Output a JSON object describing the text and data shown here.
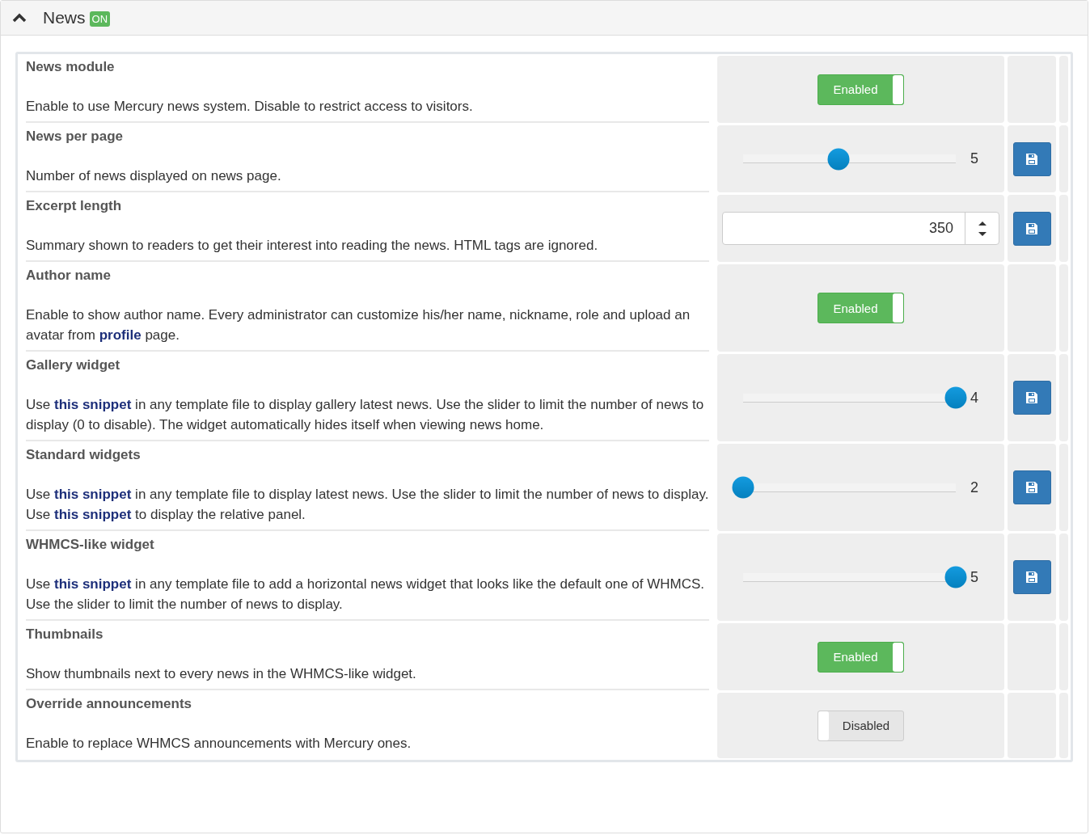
{
  "panel": {
    "title": "News",
    "badge": "ON",
    "expanded": true
  },
  "settings": [
    {
      "kind": "toggle",
      "title": "News module",
      "description": [
        {
          "text": "Enable to use Mercury news system. Disable to restrict access to visitors."
        }
      ],
      "on": true,
      "label": "Enabled"
    },
    {
      "kind": "slider",
      "title": "News per page",
      "description": [
        {
          "text": "Number of news displayed on news page."
        }
      ],
      "level": 0.45,
      "reading": "5"
    },
    {
      "kind": "number",
      "title": "Excerpt length",
      "description": [
        {
          "text": "Summary shown to readers to get their interest into reading the news. HTML tags are ignored."
        }
      ],
      "value": "350"
    },
    {
      "kind": "toggle",
      "title": "Author name",
      "description": [
        {
          "text": "Enable to show author name. Every administrator can customize his/her name, nickname, role and upload an avatar from "
        },
        {
          "link": "profile"
        },
        {
          "text": " page."
        }
      ],
      "on": true,
      "label": "Enabled"
    },
    {
      "kind": "slider",
      "title": "Gallery widget",
      "description": [
        {
          "text": "Use "
        },
        {
          "link": "this snippet"
        },
        {
          "text": " in any template file to display gallery latest news. Use the slider to limit the number of news to display (0 to disable). The widget automatically hides itself when viewing news home."
        }
      ],
      "level": 1,
      "reading": "4"
    },
    {
      "kind": "slider",
      "title": "Standard widgets",
      "description": [
        {
          "text": "Use "
        },
        {
          "link": "this snippet"
        },
        {
          "text": " in any template file to display latest news. Use the slider to limit the number of news to display. Use "
        },
        {
          "link": "this snippet"
        },
        {
          "text": " to display the relative panel."
        }
      ],
      "level": 0,
      "reading": "2"
    },
    {
      "kind": "slider",
      "title": "WHMCS-like widget",
      "description": [
        {
          "text": "Use "
        },
        {
          "link": "this snippet"
        },
        {
          "text": " in any template file to add a horizontal news widget that looks like the default one of WHMCS. Use the slider to limit the number of news to display."
        }
      ],
      "level": 1,
      "reading": "5"
    },
    {
      "kind": "toggle",
      "title": "Thumbnails",
      "description": [
        {
          "text": "Show thumbnails next to every news in the WHMCS-like widget."
        }
      ],
      "on": true,
      "label": "Enabled"
    },
    {
      "kind": "toggle",
      "title": "Override announcements",
      "description": [
        {
          "text": "Enable to replace WHMCS announcements with Mercury ones."
        }
      ],
      "on": false,
      "label": "Disabled"
    }
  ]
}
